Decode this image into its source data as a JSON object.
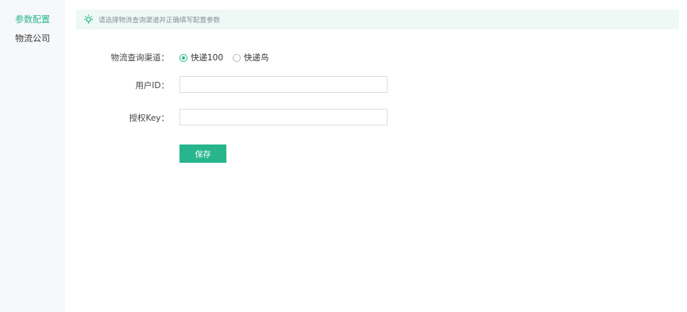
{
  "sidebar": {
    "items": [
      {
        "label": "参数配置",
        "active": true
      },
      {
        "label": "物流公司",
        "active": false
      }
    ]
  },
  "tip": {
    "icon": "lightbulb-icon",
    "text": "请选择物流查询渠道并正确填写配置参数"
  },
  "form": {
    "channel_label": "物流查询渠道：",
    "channel_options": [
      {
        "label": "快递100",
        "checked": true
      },
      {
        "label": "快递鸟",
        "checked": false
      }
    ],
    "user_id_label": "用户ID：",
    "user_id_value": "",
    "auth_key_label": "授权Key：",
    "auth_key_value": "",
    "save_label": "保存"
  },
  "colors": {
    "accent": "#27b58e",
    "tip_bg": "#eef8f4",
    "sidebar_bg": "#f7f8fa"
  }
}
